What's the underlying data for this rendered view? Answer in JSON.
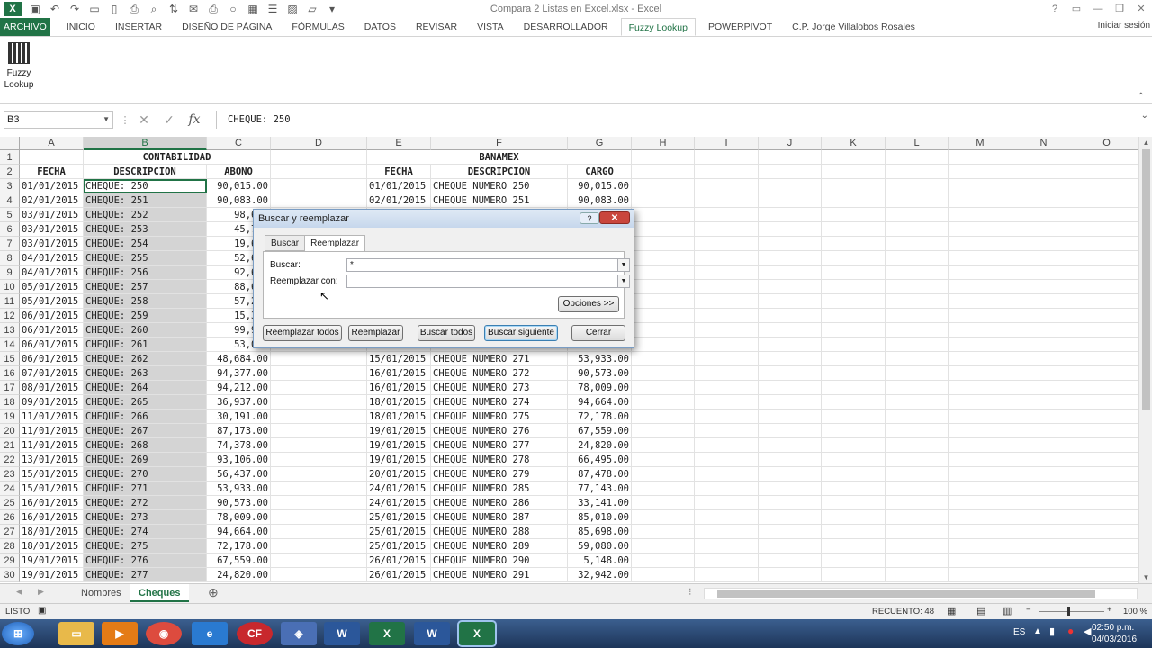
{
  "window": {
    "title": "Compara 2 Listas en Excel.xlsx - Excel",
    "signin": "Iniciar sesión"
  },
  "tabs": [
    "ARCHIVO",
    "INICIO",
    "INSERTAR",
    "DISEÑO DE PÁGINA",
    "FÓRMULAS",
    "DATOS",
    "REVISAR",
    "VISTA",
    "DESARROLLADOR",
    "Fuzzy Lookup",
    "POWERPIVOT",
    "C.P. Jorge Villalobos Rosales"
  ],
  "active_tab": "Fuzzy Lookup",
  "ribbon": {
    "fuzzy_label_1": "Fuzzy",
    "fuzzy_label_2": "Lookup"
  },
  "formula_bar": {
    "name_box": "B3",
    "formula": "CHEQUE: 250"
  },
  "columns": [
    "A",
    "B",
    "C",
    "D",
    "E",
    "F",
    "G",
    "H",
    "I",
    "J",
    "K",
    "L",
    "M",
    "N",
    "O"
  ],
  "selected_column": "B",
  "row_numbers": [
    "1",
    "2",
    "3",
    "4",
    "5",
    "6",
    "7",
    "8",
    "9",
    "10",
    "11",
    "12",
    "13",
    "14",
    "15",
    "16",
    "17",
    "18",
    "19",
    "20",
    "21",
    "22",
    "23",
    "24",
    "25",
    "26",
    "27",
    "28",
    "29",
    "30"
  ],
  "rows": [
    {
      "a": "",
      "b": "CONTABILIDAD",
      "c": "",
      "e": "",
      "f": "BANAMEX",
      "g": ""
    },
    {
      "a": "FECHA",
      "b": "DESCRIPCION",
      "c": "ABONO",
      "e": "FECHA",
      "f": "DESCRIPCION",
      "g": "CARGO"
    },
    {
      "a": "01/01/2015",
      "b": "CHEQUE: 250",
      "c": "90,015.00",
      "e": "01/01/2015",
      "f": "CHEQUE NUMERO 250",
      "g": "90,015.00"
    },
    {
      "a": "02/01/2015",
      "b": "CHEQUE: 251",
      "c": "90,083.00",
      "e": "02/01/2015",
      "f": "CHEQUE NUMERO 251",
      "g": "90,083.00"
    },
    {
      "a": "03/01/2015",
      "b": "CHEQUE: 252",
      "c": "98,651",
      "e": "",
      "f": "",
      "g": ""
    },
    {
      "a": "03/01/2015",
      "b": "CHEQUE: 253",
      "c": "45,736",
      "e": "",
      "f": "",
      "g": ""
    },
    {
      "a": "03/01/2015",
      "b": "CHEQUE: 254",
      "c": "19,602",
      "e": "",
      "f": "",
      "g": ""
    },
    {
      "a": "04/01/2015",
      "b": "CHEQUE: 255",
      "c": "52,623",
      "e": "",
      "f": "",
      "g": ""
    },
    {
      "a": "04/01/2015",
      "b": "CHEQUE: 256",
      "c": "92,601",
      "e": "",
      "f": "",
      "g": ""
    },
    {
      "a": "05/01/2015",
      "b": "CHEQUE: 257",
      "c": "88,696",
      "e": "",
      "f": "",
      "g": ""
    },
    {
      "a": "05/01/2015",
      "b": "CHEQUE: 258",
      "c": "57,244",
      "e": "",
      "f": "",
      "g": ""
    },
    {
      "a": "06/01/2015",
      "b": "CHEQUE: 259",
      "c": "15,310",
      "e": "",
      "f": "",
      "g": ""
    },
    {
      "a": "06/01/2015",
      "b": "CHEQUE: 260",
      "c": "99,976",
      "e": "",
      "f": "",
      "g": ""
    },
    {
      "a": "06/01/2015",
      "b": "CHEQUE: 261",
      "c": "53,046",
      "e": "",
      "f": "",
      "g": ""
    },
    {
      "a": "06/01/2015",
      "b": "CHEQUE: 262",
      "c": "48,684.00",
      "e": "15/01/2015",
      "f": "CHEQUE NUMERO 271",
      "g": "53,933.00"
    },
    {
      "a": "07/01/2015",
      "b": "CHEQUE: 263",
      "c": "94,377.00",
      "e": "16/01/2015",
      "f": "CHEQUE NUMERO 272",
      "g": "90,573.00"
    },
    {
      "a": "08/01/2015",
      "b": "CHEQUE: 264",
      "c": "94,212.00",
      "e": "16/01/2015",
      "f": "CHEQUE NUMERO 273",
      "g": "78,009.00"
    },
    {
      "a": "09/01/2015",
      "b": "CHEQUE: 265",
      "c": "36,937.00",
      "e": "18/01/2015",
      "f": "CHEQUE NUMERO 274",
      "g": "94,664.00"
    },
    {
      "a": "11/01/2015",
      "b": "CHEQUE: 266",
      "c": "30,191.00",
      "e": "18/01/2015",
      "f": "CHEQUE NUMERO 275",
      "g": "72,178.00"
    },
    {
      "a": "11/01/2015",
      "b": "CHEQUE: 267",
      "c": "87,173.00",
      "e": "19/01/2015",
      "f": "CHEQUE NUMERO 276",
      "g": "67,559.00"
    },
    {
      "a": "11/01/2015",
      "b": "CHEQUE: 268",
      "c": "74,378.00",
      "e": "19/01/2015",
      "f": "CHEQUE NUMERO 277",
      "g": "24,820.00"
    },
    {
      "a": "13/01/2015",
      "b": "CHEQUE: 269",
      "c": "93,106.00",
      "e": "19/01/2015",
      "f": "CHEQUE NUMERO 278",
      "g": "66,495.00"
    },
    {
      "a": "15/01/2015",
      "b": "CHEQUE: 270",
      "c": "56,437.00",
      "e": "20/01/2015",
      "f": "CHEQUE NUMERO 279",
      "g": "87,478.00"
    },
    {
      "a": "15/01/2015",
      "b": "CHEQUE: 271",
      "c": "53,933.00",
      "e": "24/01/2015",
      "f": "CHEQUE NUMERO 285",
      "g": "77,143.00"
    },
    {
      "a": "16/01/2015",
      "b": "CHEQUE: 272",
      "c": "90,573.00",
      "e": "24/01/2015",
      "f": "CHEQUE NUMERO 286",
      "g": "33,141.00"
    },
    {
      "a": "16/01/2015",
      "b": "CHEQUE: 273",
      "c": "78,009.00",
      "e": "25/01/2015",
      "f": "CHEQUE NUMERO 287",
      "g": "85,010.00"
    },
    {
      "a": "18/01/2015",
      "b": "CHEQUE: 274",
      "c": "94,664.00",
      "e": "25/01/2015",
      "f": "CHEQUE NUMERO 288",
      "g": "85,698.00"
    },
    {
      "a": "18/01/2015",
      "b": "CHEQUE: 275",
      "c": "72,178.00",
      "e": "25/01/2015",
      "f": "CHEQUE NUMERO 289",
      "g": "59,080.00"
    },
    {
      "a": "19/01/2015",
      "b": "CHEQUE: 276",
      "c": "67,559.00",
      "e": "26/01/2015",
      "f": "CHEQUE NUMERO 290",
      "g": "5,148.00"
    },
    {
      "a": "19/01/2015",
      "b": "CHEQUE: 277",
      "c": "24,820.00",
      "e": "26/01/2015",
      "f": "CHEQUE NUMERO 291",
      "g": "32,942.00"
    }
  ],
  "dialog": {
    "title": "Buscar y reemplazar",
    "help": "?",
    "close": "✕",
    "tab_find": "Buscar",
    "tab_replace": "Reemplazar",
    "find_label": "Buscar:",
    "find_value": "*",
    "replace_label": "Reemplazar con:",
    "replace_value": "",
    "options": "Opciones >>",
    "replace_all": "Reemplazar todos",
    "replace": "Reemplazar",
    "find_all": "Buscar todos",
    "find_next": "Buscar siguiente",
    "close_btn": "Cerrar"
  },
  "sheets": [
    "Nombres",
    "Cheques"
  ],
  "active_sheet": "Cheques",
  "status": {
    "mode": "LISTO",
    "count": "RECUENTO: 48",
    "zoom": "100 %"
  },
  "taskbar": {
    "lang": "ES",
    "time": "02:50 p.m.",
    "date": "04/03/2016"
  },
  "colors": {
    "excel_green": "#217346",
    "selection": "#d4d4d4"
  }
}
